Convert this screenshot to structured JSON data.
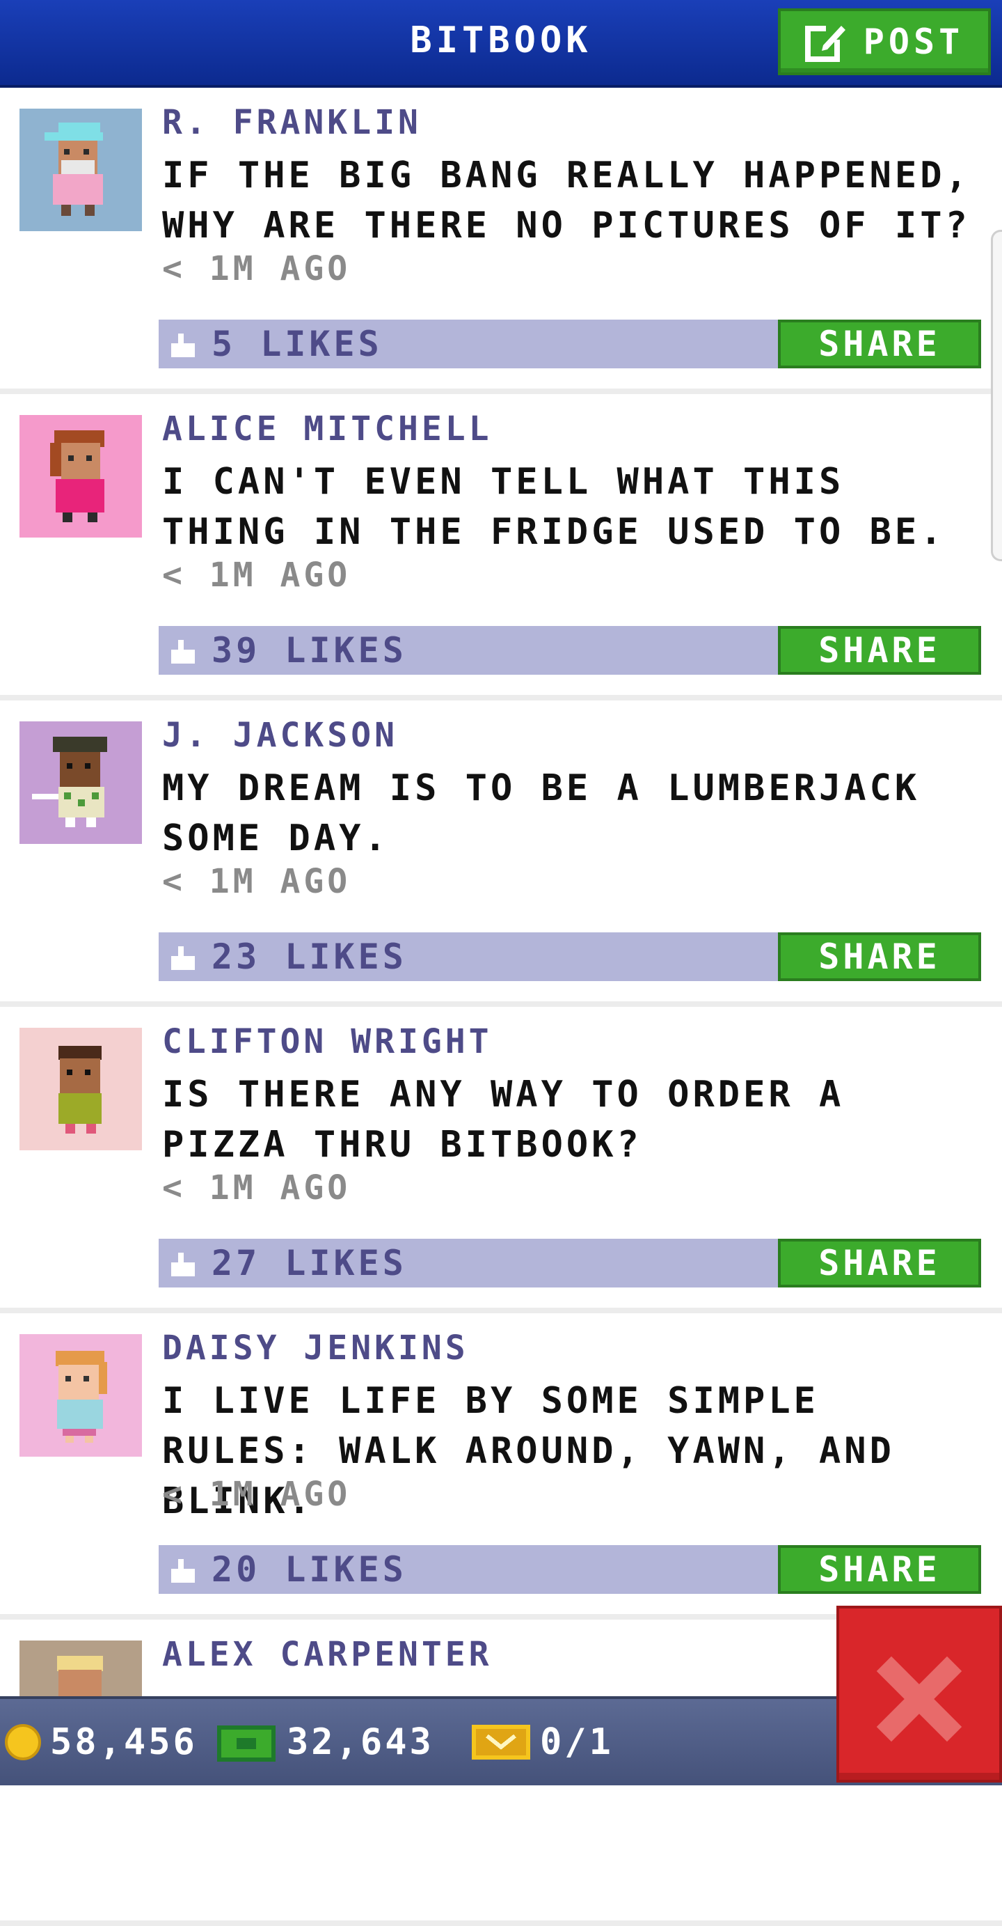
{
  "header": {
    "title": "BITBOOK",
    "post_label": "POST"
  },
  "posts": [
    {
      "author": "R. FRANKLIN",
      "message": "IF THE BIG BANG REALLY HAPPENED, WHY ARE THERE NO PICTURES OF IT?",
      "time": "< 1M AGO",
      "likes": "5 LIKES",
      "share_label": "SHARE",
      "avatar_bg": "#8fb3d0"
    },
    {
      "author": "ALICE MITCHELL",
      "message": "I CAN'T EVEN TELL WHAT THIS THING IN THE FRIDGE USED TO BE.",
      "time": "< 1M AGO",
      "likes": "39 LIKES",
      "share_label": "SHARE",
      "avatar_bg": "#f59acb"
    },
    {
      "author": "J. JACKSON",
      "message": "MY DREAM IS TO BE A LUMBERJACK SOME DAY.",
      "time": "< 1M AGO",
      "likes": "23 LIKES",
      "share_label": "SHARE",
      "avatar_bg": "#c59ed4"
    },
    {
      "author": "CLIFTON WRIGHT",
      "message": "IS THERE ANY WAY TO ORDER A PIZZA THRU BITBOOK?",
      "time": "< 1M AGO",
      "likes": "27 LIKES",
      "share_label": "SHARE",
      "avatar_bg": "#f4d0d0"
    },
    {
      "author": "DAISY JENKINS",
      "message": "I LIVE LIFE BY SOME SIMPLE RULES: WALK AROUND, YAWN, AND BLINK.",
      "time": "< 1M AGO",
      "likes": "20 LIKES",
      "share_label": "SHARE",
      "avatar_bg": "#f2b6dc"
    },
    {
      "author": "ALEX CARPENTER",
      "message": "",
      "time": "",
      "likes": "",
      "share_label": "",
      "avatar_bg": "#b49f88"
    }
  ],
  "currency": {
    "coins": "58,456",
    "bux": "32,643",
    "tickets": "0/1"
  },
  "colors": {
    "header_blue": "#1a3fb8",
    "button_green": "#3cab2c",
    "like_bar": "#b3b5d9",
    "author_purple": "#4e4b88",
    "close_red": "#d9262a"
  }
}
